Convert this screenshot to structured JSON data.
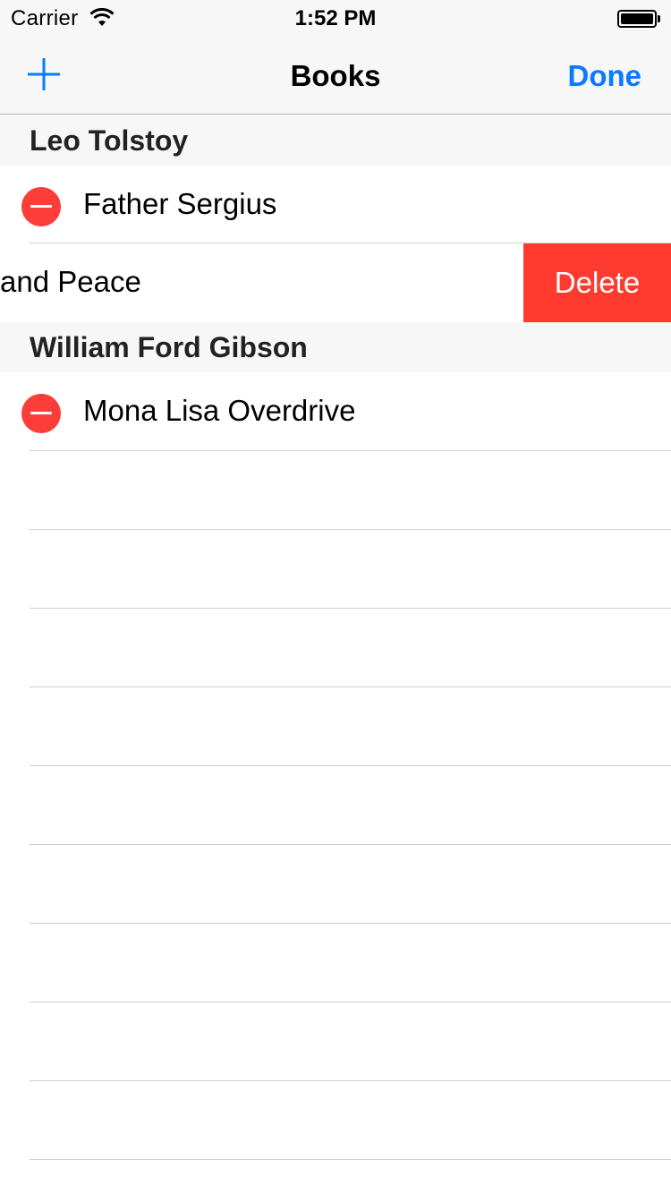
{
  "status_bar": {
    "carrier": "Carrier",
    "time": "1:52 PM",
    "wifi_icon": "wifi-icon",
    "battery_icon": "battery-icon"
  },
  "nav_bar": {
    "add_icon": "plus-icon",
    "title": "Books",
    "done_label": "Done",
    "accent_color": "#0a7aff"
  },
  "sections": [
    {
      "header": "Leo Tolstoy",
      "rows": [
        {
          "title": "Father Sergius",
          "editing_control": "minus-circle-icon"
        },
        {
          "title": "War and Peace",
          "visible_text": "and Peace",
          "swiped": true,
          "action_label": "Delete"
        }
      ]
    },
    {
      "header": "William Ford Gibson",
      "rows": [
        {
          "title": "Mona Lisa Overdrive",
          "editing_control": "minus-circle-icon"
        }
      ]
    }
  ],
  "colors": {
    "delete_red": "#ff3b30",
    "minus_red": "#fc3d39",
    "bar_background": "#f7f7f7"
  }
}
